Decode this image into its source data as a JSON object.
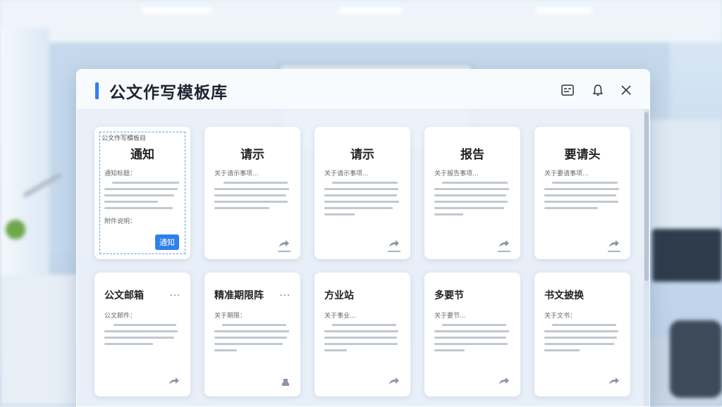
{
  "window": {
    "title": "公文作写模板库"
  },
  "icons": {
    "menu": "list-icon",
    "notify": "bell-icon",
    "close": "close-icon",
    "share": "share-arrow-icon",
    "stamp": "stamp-icon",
    "more": "more-dots-icon"
  },
  "colors": {
    "accent": "#2f80ed",
    "use_button": "#2f80ed"
  },
  "cards_row1": [
    {
      "title": "通知",
      "topline": "公文作写模板目",
      "subtitle": "通知标题：",
      "footer": "附件说明：",
      "button": "通知",
      "selected": true
    },
    {
      "title": "请示",
      "subtitle": "关于请示事项...",
      "selected": false
    },
    {
      "title": "请示",
      "subtitle": "关于请示事项...",
      "selected": false
    },
    {
      "title": "报告",
      "subtitle": "关于报告事项...",
      "selected": false
    },
    {
      "title": "要请头",
      "subtitle": "关于要请事项...",
      "selected": false
    }
  ],
  "cards_row2": [
    {
      "title": "公文邮箱",
      "subtitle": "公文邮件：",
      "more": "..."
    },
    {
      "title": "精准期限阵",
      "subtitle": "关于期限：",
      "more": "..."
    },
    {
      "title": "方业站",
      "subtitle": "关于事业...",
      "more": ""
    },
    {
      "title": "多要节",
      "subtitle": "关于要节...",
      "more": ""
    },
    {
      "title": "书文披换",
      "subtitle": "关于文书：",
      "more": ""
    }
  ]
}
